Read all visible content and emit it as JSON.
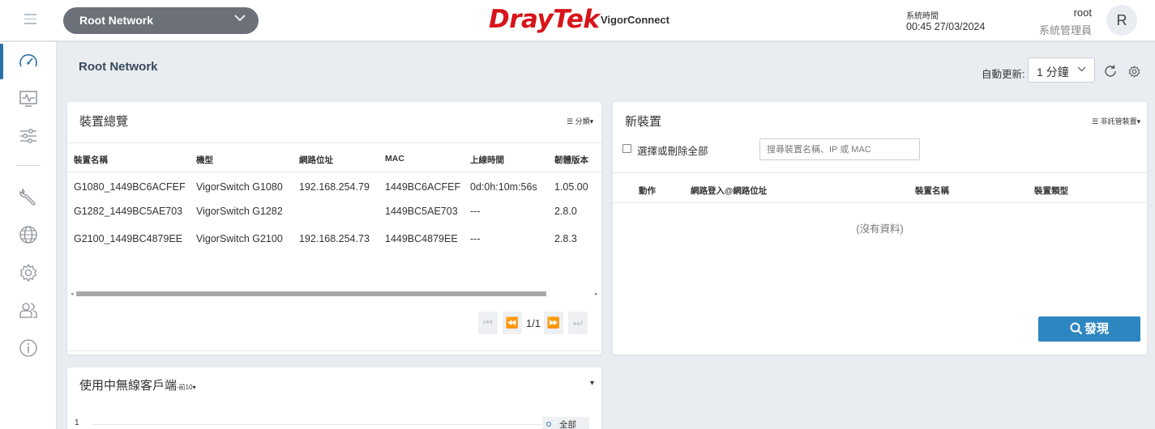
{
  "topbar": {
    "network_selector": "Root Network",
    "brand": "DrayTek",
    "product": "VigorConnect",
    "clock_label": "系統時間",
    "clock_value": "00:45 27/03/2024",
    "user_name": "root",
    "user_role": "系統管理員",
    "avatar_letter": "R"
  },
  "page": {
    "title": "Root Network",
    "auto_refresh_label": "自動更新:",
    "auto_refresh_value": "1 分鐘"
  },
  "device_overview": {
    "title": "裝置總覽",
    "menu_label": "☰ 分類▾",
    "columns": [
      "裝置名稱",
      "機型",
      "網路位址",
      "MAC",
      "上線時間",
      "韌體版本"
    ],
    "rows": [
      [
        "G1080_1449BC6ACFEF",
        "VigorSwitch G1080",
        "192.168.254.79",
        "1449BC6ACFEF",
        "0d:0h:10m:56s",
        "1.05.00"
      ],
      [
        "G1282_1449BC5AE703",
        "VigorSwitch G1282",
        "",
        "1449BC5AE703",
        "---",
        "2.8.0"
      ],
      [
        "G2100_1449BC4879EE",
        "VigorSwitch G2100",
        "192.168.254.73",
        "1449BC4879EE",
        "---",
        "2.8.3"
      ]
    ],
    "pager": "1/1"
  },
  "new_devices": {
    "title": "新裝置",
    "menu_label": "☰ 非託管裝置▾",
    "select_all_label": "選擇或刪除全部",
    "search_placeholder": "搜尋裝置名稱、IP 或 MAC",
    "search_value": "",
    "columns": [
      "動作",
      "網路登入@網路位址",
      "裝置名稱",
      "裝置類型"
    ],
    "no_data": "(沒有資料)",
    "discover_label": "發現"
  },
  "wireless_clients": {
    "title": "使用中無線客戶端",
    "subtitle": "-前10▾",
    "menu_caret": "▾",
    "y_tick": "1",
    "legend": "全部"
  },
  "colors": {
    "accent": "#2e86c1",
    "brand_red": "#d7141a",
    "selector_bg": "#6b7079",
    "background": "#e9edf1"
  },
  "icons": {
    "menu": "hamburger-icon",
    "sidebar": [
      "dashboard-icon",
      "monitor-icon",
      "sliders-icon",
      "wrench-icon",
      "globe-icon",
      "gear-icon",
      "users-icon",
      "info-icon"
    ],
    "refresh": "refresh-icon",
    "settings": "gear-icon",
    "search": "search-icon"
  }
}
